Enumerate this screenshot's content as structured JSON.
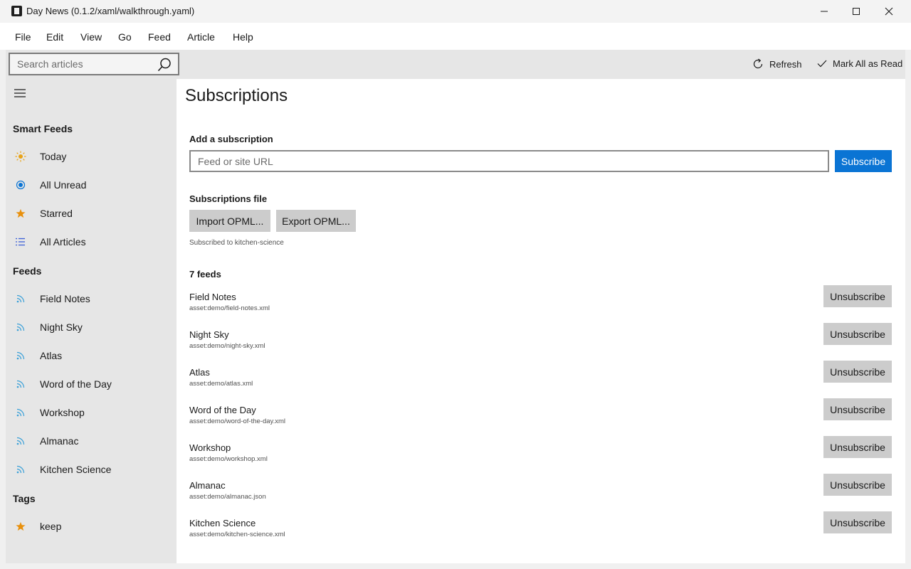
{
  "window": {
    "title": "Day News (0.1.2/xaml/walkthrough.yaml)"
  },
  "menu": [
    "File",
    "Edit",
    "View",
    "Go",
    "Feed",
    "Article",
    "Help"
  ],
  "toolbar": {
    "search_placeholder": "Search articles",
    "refresh_label": "Refresh",
    "mark_all_read_label": "Mark All as Read"
  },
  "sidebar": {
    "smart_feeds_title": "Smart Feeds",
    "smart_feeds": [
      {
        "label": "Today",
        "icon": "sun-icon"
      },
      {
        "label": "All Unread",
        "icon": "radio-icon"
      },
      {
        "label": "Starred",
        "icon": "star-icon"
      },
      {
        "label": "All Articles",
        "icon": "list-icon"
      }
    ],
    "feeds_title": "Feeds",
    "feeds": [
      "Field Notes",
      "Night Sky",
      "Atlas",
      "Word of the Day",
      "Workshop",
      "Almanac",
      "Kitchen Science"
    ],
    "tags_title": "Tags",
    "tags": [
      {
        "label": "keep",
        "icon": "star-icon"
      }
    ],
    "colors": {
      "sun": "#e8a317",
      "radio": "#0a74d4",
      "star": "#e8900c",
      "list": "#3c5fd6",
      "rss": "#3aa0d8"
    }
  },
  "main": {
    "title": "Subscriptions",
    "add_label": "Add a subscription",
    "url_placeholder": "Feed or site URL",
    "subscribe_label": "Subscribe",
    "file_label": "Subscriptions file",
    "import_label": "Import OPML...",
    "export_label": "Export OPML...",
    "status": "Subscribed to kitchen-science",
    "feeds_count": "7 feeds",
    "unsubscribe_label": "Unsubscribe",
    "feeds": [
      {
        "name": "Field Notes",
        "url": "asset:demo/field-notes.xml"
      },
      {
        "name": "Night Sky",
        "url": "asset:demo/night-sky.xml"
      },
      {
        "name": "Atlas",
        "url": "asset:demo/atlas.xml"
      },
      {
        "name": "Word of the Day",
        "url": "asset:demo/word-of-the-day.xml"
      },
      {
        "name": "Workshop",
        "url": "asset:demo/workshop.xml"
      },
      {
        "name": "Almanac",
        "url": "asset:demo/almanac.json"
      },
      {
        "name": "Kitchen Science",
        "url": "asset:demo/kitchen-science.xml"
      }
    ]
  }
}
